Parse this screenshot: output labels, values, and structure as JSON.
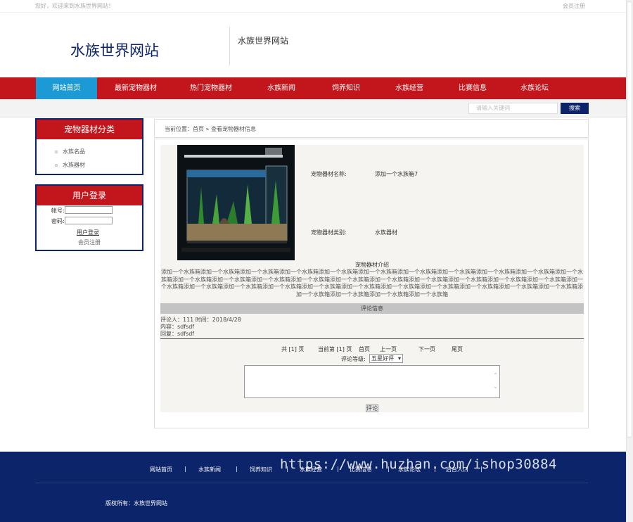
{
  "topbar": {
    "welcome": "您好，欢迎来到水族世界网站！",
    "register": "会员注册"
  },
  "header": {
    "logo_title": "水族世界网站",
    "subtitle": "水族世界网站"
  },
  "nav": {
    "items": [
      {
        "label": "网站首页"
      },
      {
        "label": "最新宠物器材"
      },
      {
        "label": "热门宠物器材"
      },
      {
        "label": "水族新闻"
      },
      {
        "label": "饲养知识"
      },
      {
        "label": "水族经营"
      },
      {
        "label": "比赛信息"
      },
      {
        "label": "水族论坛"
      }
    ]
  },
  "search": {
    "placeholder": "请输入关键词",
    "button": "搜索"
  },
  "sidebar": {
    "category_title": "宠物器材分类",
    "categories": [
      {
        "label": "水族名品"
      },
      {
        "label": "水族器材"
      }
    ],
    "login_title": "用户登录",
    "account_label": "帐号:",
    "password_label": "密码:",
    "login_button": "用户登录",
    "register_link": "会员注册"
  },
  "breadcrumb": "当前位置：首页 » 查看宠物器材信息",
  "product": {
    "name_label": "宠物器材名称:",
    "name_value": "添加一个水族箱7",
    "category_label": "宠物器材类别:",
    "category_value": "水族器材",
    "intro_title": "宠物器材介绍",
    "intro_body": "添加一个水族箱添加一个水族箱添加一个水族箱添加一个水族箱添加一个水族箱添加一个水族箱添加一个水族箱添加一个水族箱添加一个水族箱添加一个水族箱添加一个水族箱添加一个水族箱添加一个水族箱添加一个水族箱添加一个水族箱添加一个水族箱添加一个水族箱添加一个水族箱添加一个水族箱添加一个水族箱添加一个水族箱添加一个水族箱添加一个水族箱添加一个水族箱添加一个水族箱添加一个水族箱添加一个水族箱添加一个水族箱添加一个水族箱添加一个水族箱添加一个水族箱添加一个水族箱添加一个水族箱添加一个水族箱添加一个水族箱添加一个水族箱"
  },
  "comments": {
    "header": "评论信息",
    "commenter_line": "评论人：111 时间：2018/4/28",
    "content_line": "内容：sdfsdf",
    "reply_line": "回复：sdfsdf"
  },
  "pager": {
    "total": "共 [1] 页",
    "current": "当前第 [1] 页",
    "first": "首页",
    "prev": "上一页",
    "next": "下一页",
    "last": "尾页"
  },
  "rating": {
    "label": "评论等级:",
    "selected": "五星好评"
  },
  "submit_label": "评论",
  "footer": {
    "links": [
      {
        "label": "网站首页"
      },
      {
        "label": "水族新闻"
      },
      {
        "label": "饲养知识"
      },
      {
        "label": "水族经营"
      },
      {
        "label": "比赛信息"
      },
      {
        "label": "水族论坛"
      },
      {
        "label": "后台入口"
      }
    ],
    "separator": "|",
    "copyright": "版权所有：水族世界网站",
    "watermark": "https://www.huzhan.com/ishop30884"
  },
  "colors": {
    "nav_red": "#c3161c",
    "nav_active": "#1b9ad6",
    "navy": "#0c2469"
  }
}
